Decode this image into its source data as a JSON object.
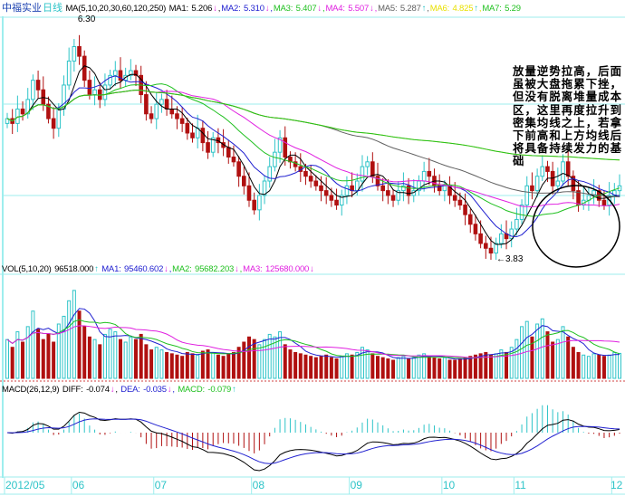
{
  "header": {
    "stock_name": "中福实业",
    "period": "日线",
    "ma_params": "MA(5,10,20,30,60,120,250)",
    "ma_values": [
      {
        "label": "MA1:",
        "value": "5.206",
        "arrow": "↓",
        "color": "#000000"
      },
      {
        "label": "MA2:",
        "value": "5.310",
        "arrow": "↓",
        "color": "#2020d0"
      },
      {
        "label": "MA3:",
        "value": "5.407",
        "arrow": "↓",
        "color": "#20c020"
      },
      {
        "label": "MA4:",
        "value": "5.507",
        "arrow": "↓",
        "color": "#e020e0"
      },
      {
        "label": "MA5:",
        "value": "5.287",
        "arrow": "↑",
        "color": "#606060"
      },
      {
        "label": "MA6:",
        "value": "4.825",
        "arrow": "↑",
        "color": "#e8e000"
      },
      {
        "label": "MA7:",
        "value": "5.29",
        "arrow": "",
        "color": "#20c020"
      }
    ]
  },
  "vol_header": {
    "params": "VOL(5,10,20)",
    "value": "96518.000",
    "value_arrow": "↑",
    "ma": [
      {
        "label": "MA1:",
        "value": "95460.602",
        "arrow": "↓",
        "color": "#2020d0"
      },
      {
        "label": "MA2:",
        "value": "95682.203",
        "arrow": "↓",
        "color": "#20c020"
      },
      {
        "label": "MA3:",
        "value": "125680.000",
        "arrow": "↓",
        "color": "#e020e0"
      }
    ]
  },
  "macd_header": {
    "params": "MACD(26,12,9)",
    "diff": {
      "label": "DIFF:",
      "value": "-0.074",
      "arrow": "↓",
      "color": "#000000"
    },
    "dea": {
      "label": "DEA:",
      "value": "-0.035",
      "arrow": "↓",
      "color": "#2020d0"
    },
    "macd": {
      "label": "MACD:",
      "value": "-0.079",
      "arrow": "↑",
      "color": "#20c020"
    }
  },
  "annotation": "放量逆势拉高，后面虽被大盘拖累下挫，但没有脱离堆量成本区，这里再度拉升到密集均线之上，若拿下前高和上方均线后将具备持续发力的基础",
  "colors": {
    "up": "#2ec4c8",
    "down": "#b01010",
    "grid": "#9eeeee"
  },
  "chart_data": {
    "type": "candlestick",
    "title": "中福实业 日线",
    "price_range": [
      3.83,
      6.3
    ],
    "max_label": "6.30",
    "min_label": "3.83",
    "closes": [
      5.3,
      5.25,
      5.4,
      5.35,
      5.5,
      5.7,
      5.6,
      5.45,
      5.3,
      5.2,
      5.4,
      5.65,
      5.9,
      6.05,
      5.95,
      5.7,
      5.55,
      5.6,
      5.5,
      5.65,
      5.75,
      5.8,
      5.7,
      5.75,
      5.8,
      5.75,
      5.55,
      5.35,
      5.3,
      5.45,
      5.5,
      5.4,
      5.35,
      5.3,
      5.25,
      5.15,
      5.1,
      5.2,
      5.05,
      4.95,
      5.1,
      5.05,
      5.0,
      4.9,
      4.85,
      4.7,
      4.6,
      4.45,
      4.35,
      4.5,
      4.65,
      4.8,
      4.95,
      5.1,
      4.9,
      4.85,
      4.8,
      4.75,
      4.7,
      4.65,
      4.6,
      4.55,
      4.5,
      4.45,
      4.4,
      4.5,
      4.6,
      4.55,
      4.65,
      4.8,
      4.85,
      4.7,
      4.6,
      4.55,
      4.5,
      4.45,
      4.55,
      4.6,
      4.5,
      4.55,
      4.65,
      4.75,
      4.7,
      4.6,
      4.55,
      4.6,
      4.5,
      4.45,
      4.4,
      4.3,
      4.2,
      4.1,
      4.0,
      3.95,
      3.9,
      4.0,
      4.1,
      4.05,
      4.15,
      4.25,
      4.4,
      4.6,
      4.55,
      4.7,
      4.8,
      4.75,
      4.6,
      4.65,
      4.85,
      4.7,
      4.55,
      4.4,
      4.45,
      4.5,
      4.55,
      4.45,
      4.4,
      4.5,
      4.55,
      4.6
    ],
    "volumes": [
      150000,
      120000,
      180000,
      140000,
      200000,
      260000,
      190000,
      150000,
      170000,
      140000,
      210000,
      240000,
      300000,
      340000,
      260000,
      200000,
      160000,
      150000,
      130000,
      170000,
      190000,
      180000,
      150000,
      140000,
      160000,
      150000,
      170000,
      130000,
      110000,
      120000,
      110000,
      100000,
      95000,
      90000,
      85000,
      100000,
      95000,
      90000,
      105000,
      110000,
      100000,
      90000,
      85000,
      95000,
      100000,
      120000,
      140000,
      160000,
      150000,
      130000,
      150000,
      170000,
      160000,
      180000,
      130000,
      110000,
      100000,
      95000,
      90000,
      85000,
      80000,
      85000,
      90000,
      80000,
      75000,
      85000,
      95000,
      90000,
      100000,
      120000,
      110000,
      95000,
      85000,
      80000,
      75000,
      70000,
      80000,
      85000,
      75000,
      80000,
      90000,
      95000,
      85000,
      80000,
      75000,
      80000,
      70000,
      70000,
      75000,
      80000,
      85000,
      90000,
      95000,
      100000,
      90000,
      95000,
      110000,
      100000,
      120000,
      150000,
      200000,
      220000,
      160000,
      210000,
      230000,
      180000,
      140000,
      150000,
      200000,
      160000,
      120000,
      100000,
      90000,
      85000,
      95000,
      90000,
      85000,
      90000,
      100000,
      96518
    ],
    "vol_max": 350000,
    "x_ticks": [
      {
        "label": "2012/05",
        "day": 0
      },
      {
        "label": "06",
        "day": 13
      },
      {
        "label": "07",
        "day": 29
      },
      {
        "label": "08",
        "day": 48
      },
      {
        "label": "09",
        "day": 67
      },
      {
        "label": "10",
        "day": 85
      },
      {
        "label": "11",
        "day": 99
      },
      {
        "label": "12",
        "day": 118
      }
    ],
    "ma_periods": [
      5,
      10,
      20,
      30,
      60,
      120,
      250
    ]
  }
}
